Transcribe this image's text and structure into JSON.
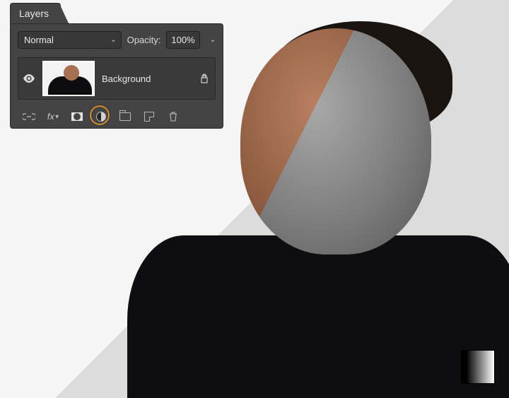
{
  "panel": {
    "tab_label": "Layers",
    "blend_mode": "Normal",
    "opacity_label": "Opacity:",
    "opacity_value": "100%"
  },
  "layer": {
    "name": "Background"
  },
  "icons": {
    "eye": "visibility-icon",
    "lock": "lock-icon",
    "link": "link-layers-icon",
    "fx": "fx",
    "mask": "add-layer-mask-icon",
    "adjustment": "adjustment-layer-icon",
    "group": "new-group-icon",
    "new": "new-layer-icon",
    "trash": "delete-layer-icon"
  }
}
